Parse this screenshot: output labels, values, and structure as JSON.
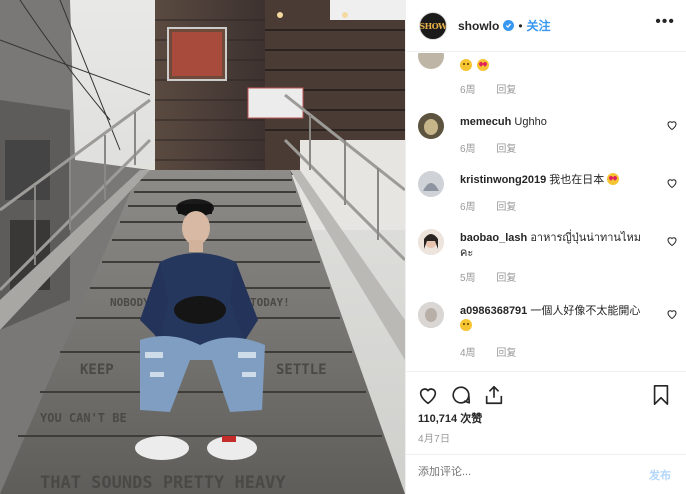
{
  "post": {
    "username": "showlo",
    "follow_label": "关注",
    "separator": "•",
    "more_label": "•••",
    "avatar_text": "SHOW",
    "stair_text": [
      "THAT SOUNDS PRETTY HEAVY",
      "YOU CAN'T BE",
      "KEEP",
      "SETTLE",
      "NOBODY",
      "TODAY!"
    ]
  },
  "comments": [
    {
      "username": "",
      "text": "",
      "emojis": [
        "sad",
        "heart-eyes"
      ],
      "time": "6周",
      "reply": "回复"
    },
    {
      "username": "memecuh",
      "text": "Ughho",
      "emojis": [],
      "time": "6周",
      "reply": "回复"
    },
    {
      "username": "kristinwong2019",
      "text": "我也在日本",
      "emojis": [
        "heart-eyes"
      ],
      "time": "6周",
      "reply": "回复"
    },
    {
      "username": "baobao_lash",
      "text": "อาหารญี่ปุ่นน่าทานไหมคะ",
      "emojis": [],
      "time": "5周",
      "reply": "回复"
    },
    {
      "username": "a0986368791",
      "text": "一個人好像不太能開心",
      "emojis": [
        "sad"
      ],
      "time": "4周",
      "reply": "回复"
    }
  ],
  "stats": {
    "likes": "110,714 次赞",
    "date": "4月7日"
  },
  "add_comment": {
    "placeholder": "添加评论...",
    "post_label": "发布"
  },
  "icons": {
    "like": "heart-icon",
    "comment": "comment-icon",
    "share": "share-icon",
    "save": "bookmark-icon",
    "verified": "verified-badge-icon",
    "more": "more-options-icon"
  },
  "colors": {
    "accent": "#3897f0",
    "muted": "#999999",
    "border": "#efefef"
  }
}
